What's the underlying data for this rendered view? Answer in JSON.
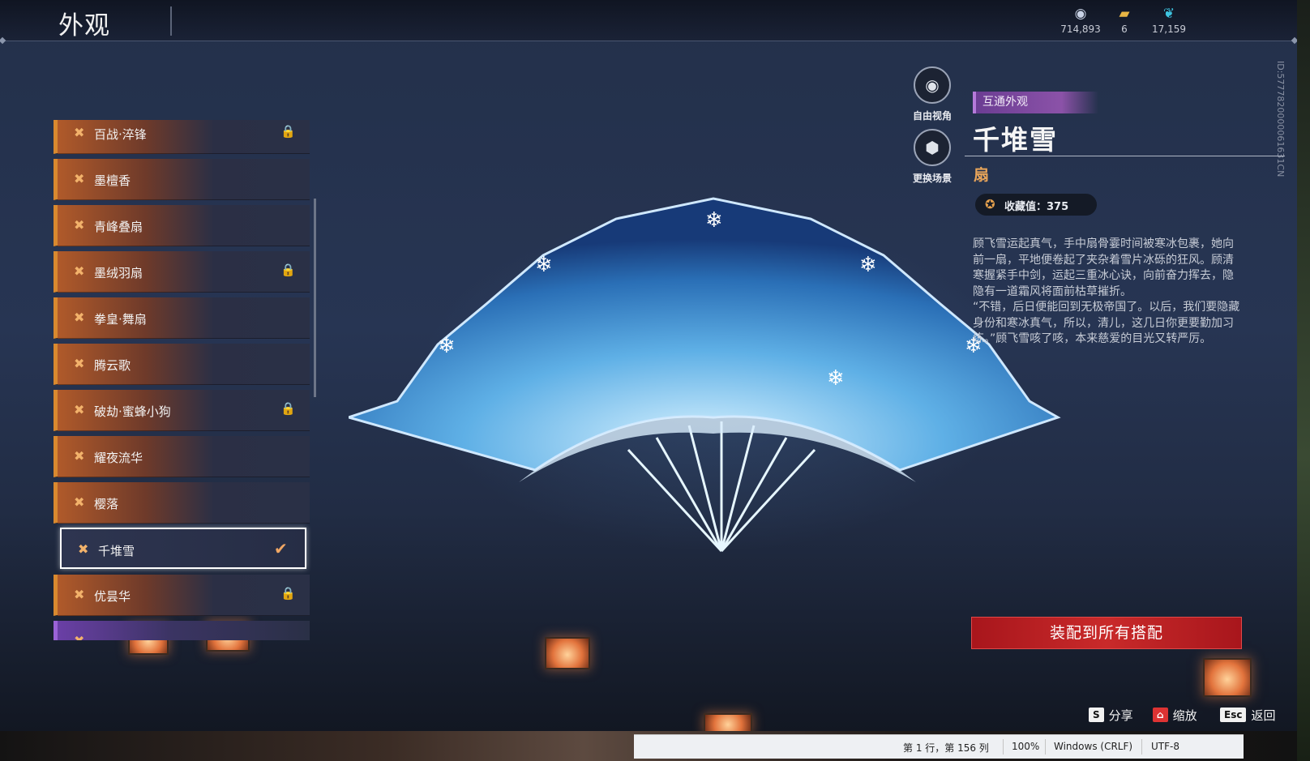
{
  "header": {
    "title": "外观",
    "currencies": [
      {
        "icon": "silver-coin-icon",
        "value": "714,893",
        "color": "#c9d3e6"
      },
      {
        "icon": "gold-ticket-icon",
        "value": "6",
        "color": "#e8b545"
      },
      {
        "icon": "jade-feather-icon",
        "value": "17,159",
        "color": "#3ec4e0"
      }
    ]
  },
  "side_id": "ID:5777820000061631CN",
  "list": {
    "items": [
      {
        "name": "百战·淬锋",
        "locked": true
      },
      {
        "name": "墨檀香",
        "locked": false
      },
      {
        "name": "青峰叠扇",
        "locked": false
      },
      {
        "name": "墨绒羽扇",
        "locked": true
      },
      {
        "name": "拳皇·舞扇",
        "locked": false
      },
      {
        "name": "腾云歌",
        "locked": false
      },
      {
        "name": "破劫·蜜蜂小狗",
        "locked": true
      },
      {
        "name": "耀夜流华",
        "locked": false
      },
      {
        "name": "樱落",
        "locked": false
      },
      {
        "name": "千堆雪",
        "locked": false,
        "selected": true
      },
      {
        "name": "优昙华",
        "locked": true
      },
      {
        "name": "",
        "locked": false
      }
    ]
  },
  "camera": {
    "free_view_label": "自由视角",
    "change_scene_label": "更换场景"
  },
  "detail": {
    "tag": "互通外观",
    "title": "千堆雪",
    "category": "扇",
    "collection": "收藏值：375",
    "description": "顾飞雪运起真气，手中扇骨霎时间被寒冰包裹，她向前一扇，平地便卷起了夹杂着雪片冰砾的狂风。顾清寒握紧手中剑，运起三重冰心诀，向前奋力挥去，隐隐有一道霜风将面前枯草摧折。\n“不错，后日便能回到无极帝国了。以后，我们要隐藏身份和寒冰真气，所以，清儿，这几日你更要勤加习练。”顾飞雪咳了咳，本来慈爱的目光又转严厉。"
  },
  "equip_button": "装配到所有搭配",
  "hints": [
    {
      "key": "S",
      "label": "分享"
    },
    {
      "key": "⌂",
      "label": "缩放"
    },
    {
      "key": "Esc",
      "label": "返回"
    }
  ],
  "statusbar": {
    "position": "第 1 行，第 156 列",
    "zoom": "100%",
    "line_ending": "Windows (CRLF)",
    "encoding": "UTF-8"
  },
  "colors": {
    "accent_orange": "#d9892f",
    "equip_red": "#c92a2a",
    "tag_purple": "#8b52a8"
  }
}
